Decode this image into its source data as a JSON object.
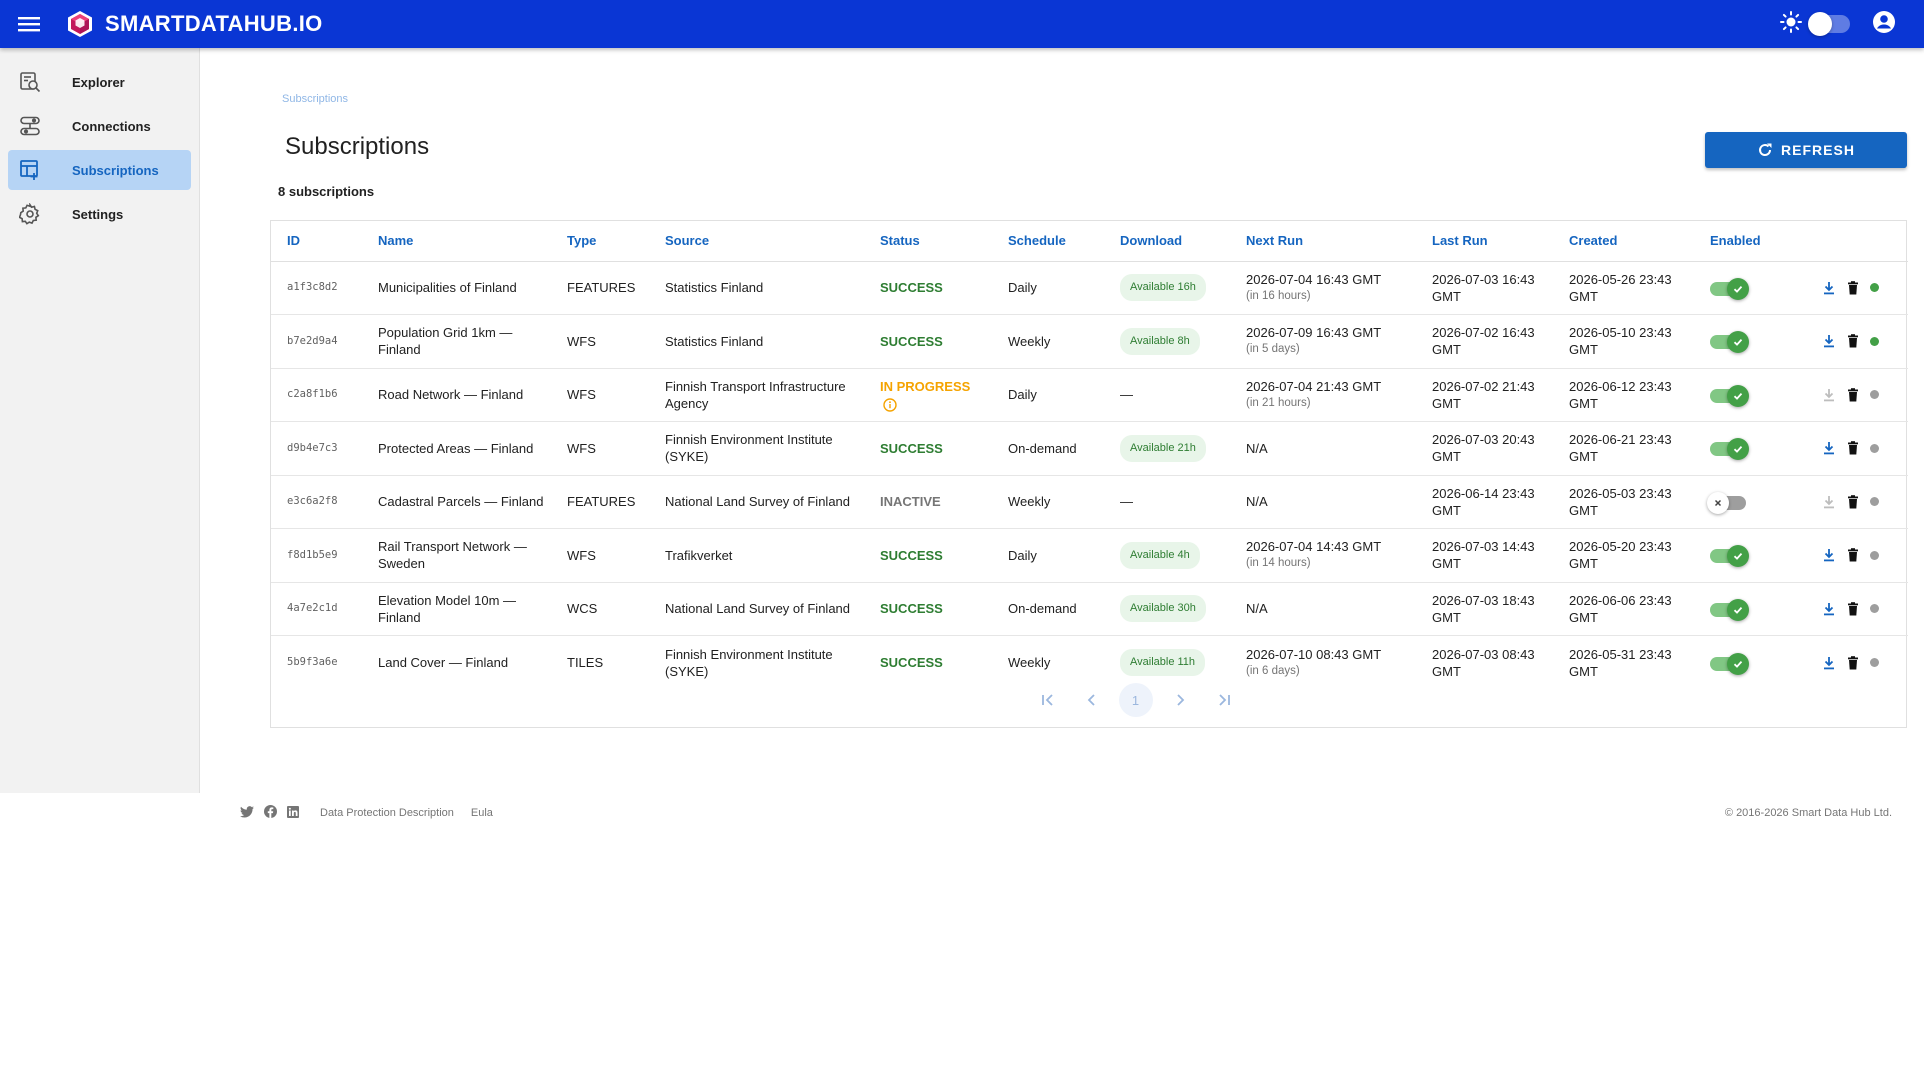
{
  "app": {
    "brand": "SMARTDATAHUB.IO"
  },
  "colors": {
    "topbar": "#0a36d4",
    "accent": "#1565c0",
    "success": "#2e7d32",
    "progress": "#f5a300",
    "inactive": "#757575"
  },
  "sidebar": {
    "items": [
      {
        "label": "Explorer",
        "icon": "search-data-icon"
      },
      {
        "label": "Connections",
        "icon": "connections-icon"
      },
      {
        "label": "Subscriptions",
        "icon": "subscriptions-icon",
        "active": true
      },
      {
        "label": "Settings",
        "icon": "gear-icon"
      }
    ]
  },
  "main": {
    "breadcrumb": "Subscriptions",
    "title": "Subscriptions",
    "refresh_label": "REFRESH",
    "count_text": "8 subscriptions"
  },
  "table": {
    "columns": [
      "ID",
      "Name",
      "Type",
      "Source",
      "Status",
      "Schedule",
      "Download",
      "Next Run",
      "Last Run",
      "Created",
      "Enabled"
    ],
    "rows": [
      {
        "id": "a1f3c8d2",
        "name": "Municipalities of Finland",
        "type": "FEATURES",
        "source": "Statistics Finland",
        "status": "SUCCESS",
        "schedule": "Daily",
        "download": "Available  16h",
        "next_run": "2026-07-04 16:43 GMT",
        "next_run_rel": "(in 16 hours)",
        "last_run": "2026-07-03 16:43 GMT",
        "created": "2026-05-26 23:43 GMT",
        "enabled": true
      },
      {
        "id": "b7e2d9a4",
        "name": "Population Grid 1km — Finland",
        "type": "WFS",
        "source": "Statistics Finland",
        "status": "SUCCESS",
        "schedule": "Weekly",
        "download": "Available  8h",
        "next_run": "2026-07-09 16:43 GMT",
        "next_run_rel": "(in 5 days)",
        "last_run": "2026-07-02 16:43 GMT",
        "created": "2026-05-10 23:43 GMT",
        "enabled": true
      },
      {
        "id": "c2a8f1b6",
        "name": "Road Network — Finland",
        "type": "WFS",
        "source": "Finnish Transport Infrastructure Agency",
        "status": "IN PROGRESS",
        "schedule": "Daily",
        "download": "—",
        "next_run": "2026-07-04 21:43 GMT",
        "next_run_rel": "(in 21 hours)",
        "last_run": "2026-07-02 21:43 GMT",
        "created": "2026-06-12 23:43 GMT",
        "enabled": true
      },
      {
        "id": "d9b4e7c3",
        "name": "Protected Areas — Finland",
        "type": "WFS",
        "source": "Finnish Environment Institute (SYKE)",
        "status": "SUCCESS",
        "schedule": "On-demand",
        "download": "Available  21h",
        "next_run": "N/A",
        "next_run_rel": "",
        "last_run": "2026-07-03 20:43 GMT",
        "created": "2026-06-21 23:43 GMT",
        "enabled": true
      },
      {
        "id": "e3c6a2f8",
        "name": "Cadastral Parcels — Finland",
        "type": "FEATURES",
        "source": "National Land Survey of Finland",
        "status": "INACTIVE",
        "schedule": "Weekly",
        "download": "—",
        "next_run": "N/A",
        "next_run_rel": "",
        "last_run": "2026-06-14 23:43 GMT",
        "created": "2026-05-03 23:43 GMT",
        "enabled": false
      },
      {
        "id": "f8d1b5e9",
        "name": "Rail Transport Network — Sweden",
        "type": "WFS",
        "source": "Trafikverket",
        "status": "SUCCESS",
        "schedule": "Daily",
        "download": "Available  4h",
        "next_run": "2026-07-04 14:43 GMT",
        "next_run_rel": "(in 14 hours)",
        "last_run": "2026-07-03 14:43 GMT",
        "created": "2026-05-20 23:43 GMT",
        "enabled": true
      },
      {
        "id": "4a7e2c1d",
        "name": "Elevation Model 10m — Finland",
        "type": "WCS",
        "source": "National Land Survey of Finland",
        "status": "SUCCESS",
        "schedule": "On-demand",
        "download": "Available  30h",
        "next_run": "N/A",
        "next_run_rel": "",
        "last_run": "2026-07-03 18:43 GMT",
        "created": "2026-06-06 23:43 GMT",
        "enabled": true
      },
      {
        "id": "5b9f3a6e",
        "name": "Land Cover — Finland",
        "type": "TILES",
        "source": "Finnish Environment Institute (SYKE)",
        "status": "SUCCESS",
        "schedule": "Weekly",
        "download": "Available  11h",
        "next_run": "2026-07-10 08:43 GMT",
        "next_run_rel": "(in 6 days)",
        "last_run": "2026-07-03 08:43 GMT",
        "created": "2026-05-31 23:43 GMT",
        "enabled": true
      }
    ]
  },
  "pagination": {
    "current_page": "1"
  },
  "footer": {
    "links": [
      "Data Protection Description",
      "Eula"
    ],
    "copyright": "© 2016-2026 Smart Data Hub Ltd."
  }
}
